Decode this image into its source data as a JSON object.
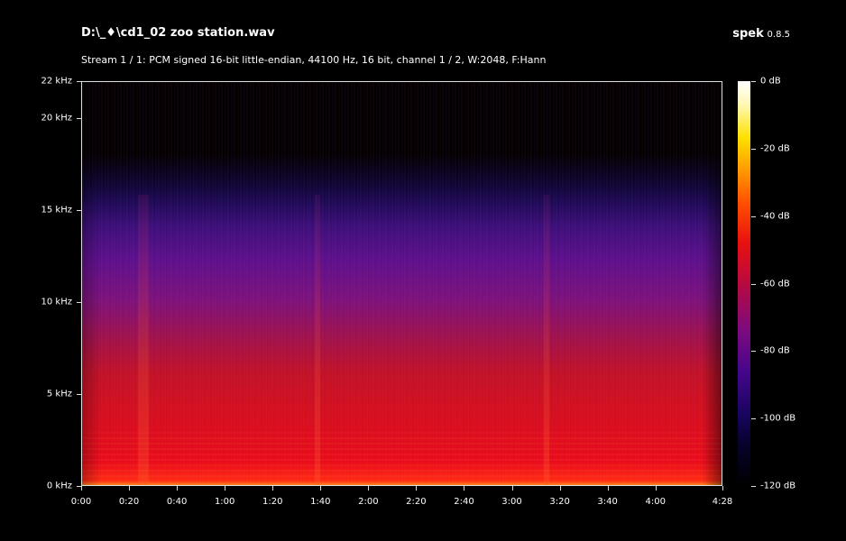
{
  "header": {
    "file_title": "D:\\_♦\\cd1_02 zoo station.wav",
    "stream_info": "Stream 1 / 1: PCM signed 16-bit little-endian, 44100 Hz, 16 bit, channel 1 / 2, W:2048, F:Hann",
    "app_name": "spek",
    "app_version": "0.8.5"
  },
  "y_axis": {
    "ticks": [
      "22 kHz",
      "20 kHz",
      "15 kHz",
      "10 kHz",
      "5 kHz",
      "0 kHz"
    ],
    "values_khz": [
      22,
      20,
      15,
      10,
      5,
      0
    ],
    "range_khz": [
      0,
      22
    ]
  },
  "x_axis": {
    "ticks": [
      "0:00",
      "0:20",
      "0:40",
      "1:00",
      "1:20",
      "1:40",
      "2:00",
      "2:20",
      "2:40",
      "3:00",
      "3:20",
      "3:40",
      "4:00",
      "4:28"
    ],
    "values_s": [
      0,
      20,
      40,
      60,
      80,
      100,
      120,
      140,
      160,
      180,
      200,
      220,
      240,
      268
    ],
    "range_s": [
      0,
      268
    ]
  },
  "colorbar": {
    "ticks": [
      "0 dB",
      "-20 dB",
      "-40 dB",
      "-60 dB",
      "-80 dB",
      "-100 dB",
      "-120 dB"
    ],
    "values_db": [
      0,
      -20,
      -40,
      -60,
      -80,
      -100,
      -120
    ],
    "range_db": [
      -120,
      0
    ]
  },
  "colors": {
    "background": "#000000",
    "text": "#ffffff",
    "frame": "#dddddd"
  }
}
